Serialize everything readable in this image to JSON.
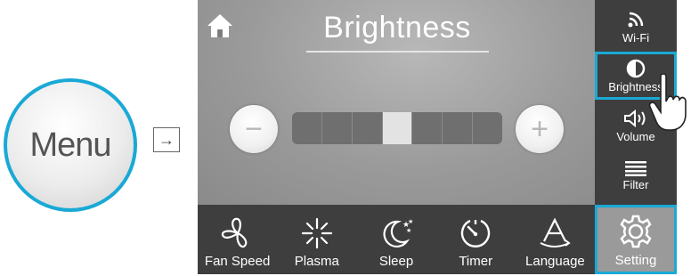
{
  "menu_button": {
    "label": "Menu"
  },
  "arrow": {
    "glyph": "→"
  },
  "screen": {
    "title": "Brightness",
    "level": {
      "active_segment": 4,
      "total_segments": 7
    },
    "minus_glyph": "−",
    "plus_glyph": "+"
  },
  "sidebar": {
    "items": [
      {
        "label": "Wi-Fi",
        "icon": "wifi-icon"
      },
      {
        "label": "Brightness",
        "icon": "brightness-icon",
        "active": true
      },
      {
        "label": "Volume",
        "icon": "volume-icon"
      },
      {
        "label": "Filter",
        "icon": "filter-icon"
      }
    ]
  },
  "bottombar": {
    "items": [
      {
        "label": "Fan Speed",
        "icon": "fan-icon"
      },
      {
        "label": "Plasma",
        "icon": "plasma-icon"
      },
      {
        "label": "Sleep",
        "icon": "sleep-icon"
      },
      {
        "label": "Timer",
        "icon": "timer-icon"
      },
      {
        "label": "Language",
        "icon": "language-icon"
      }
    ],
    "setting": {
      "label": "Setting",
      "icon": "gear-icon",
      "active": true
    }
  },
  "colors": {
    "accent": "#19a9d6",
    "bar_bg": "#3e3e3e",
    "screen_bg": "#9a9a9a"
  }
}
